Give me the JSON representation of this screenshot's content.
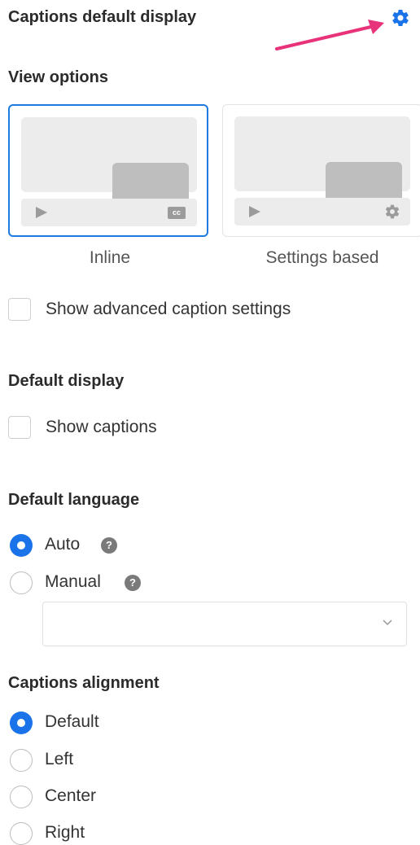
{
  "header": {
    "title": "Captions default display",
    "icon": "gear-icon",
    "accent": "#1a73e8",
    "arrow_color": "#e8327a"
  },
  "view_options": {
    "title": "View options",
    "cards": [
      {
        "label": "Inline",
        "selected": true,
        "control_icon": "cc-icon",
        "cc_text": "cc"
      },
      {
        "label": "Settings based",
        "selected": false,
        "control_icon": "gear-icon"
      }
    ]
  },
  "advanced": {
    "label": "Show advanced caption settings",
    "checked": false
  },
  "default_display": {
    "title": "Default display",
    "show_captions_label": "Show captions",
    "checked": false
  },
  "default_language": {
    "title": "Default language",
    "options": [
      {
        "label": "Auto",
        "checked": true,
        "help": "?"
      },
      {
        "label": "Manual",
        "checked": false,
        "help": "?"
      }
    ],
    "select_value": ""
  },
  "alignment": {
    "title": "Captions alignment",
    "options": [
      {
        "label": "Default",
        "checked": true
      },
      {
        "label": "Left",
        "checked": false
      },
      {
        "label": "Center",
        "checked": false
      },
      {
        "label": "Right",
        "checked": false
      }
    ]
  }
}
